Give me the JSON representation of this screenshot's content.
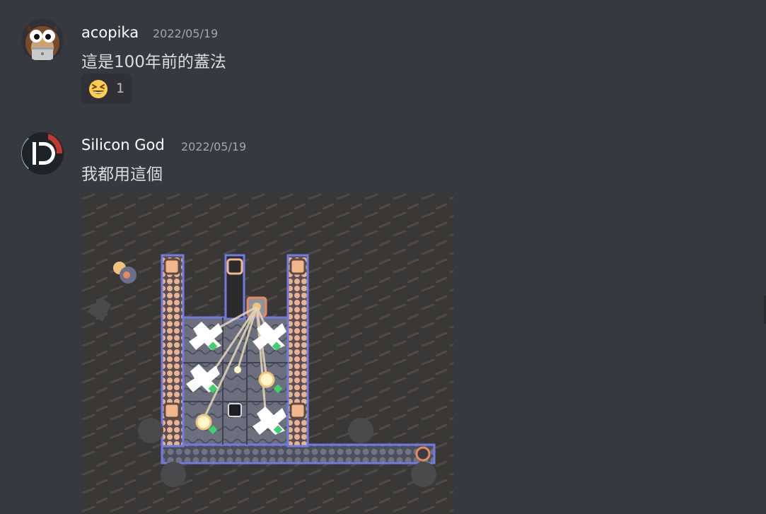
{
  "messages": [
    {
      "author": "acopika",
      "timestamp": "2022/05/19",
      "text": "這是100年前的蓋法",
      "avatar_icon": "owl-avatar-icon",
      "reactions": [
        {
          "emoji_icon": "grinning-squinting-face-icon",
          "count": "1"
        }
      ]
    },
    {
      "author": "Silicon God",
      "timestamp": "2022/05/19",
      "text": "我都用這個",
      "avatar_icon": "d-logo-avatar-icon",
      "attachment": {
        "type": "image",
        "subject": "factory-layout-screenshot"
      }
    }
  ],
  "colors": {
    "background": "#36393f",
    "username": "#ffffff",
    "timestamp": "#a3a6aa",
    "message_text": "#dcddde",
    "reaction_bg": "#2f3136"
  }
}
